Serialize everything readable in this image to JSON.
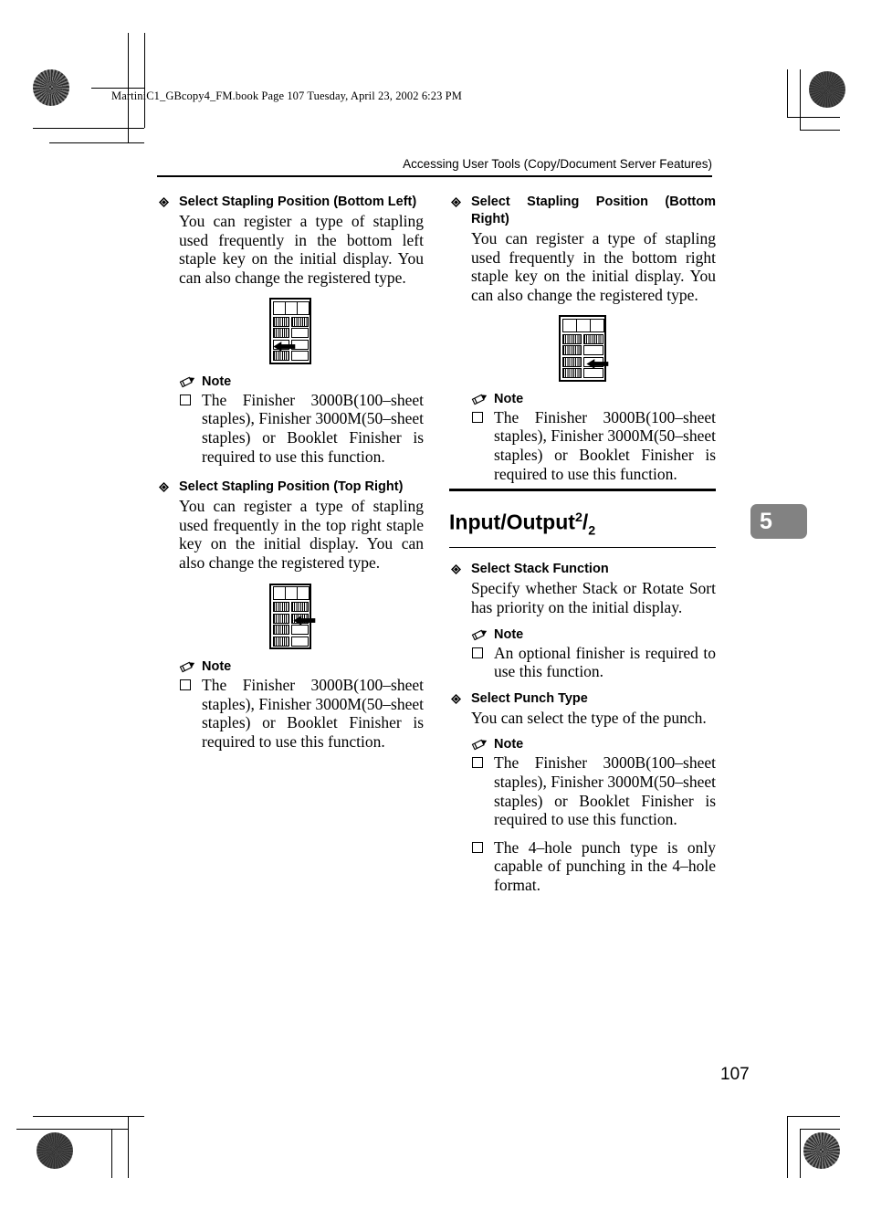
{
  "document": {
    "file_header": "MartiniC1_GBcopy4_FM.book  Page 107  Tuesday, April 23, 2002  6:23 PM",
    "running_head": "Accessing User Tools (Copy/Document Server Features)",
    "chapter_tab": "5",
    "page_number": "107",
    "tab_color": "#828282"
  },
  "left_column": {
    "block1": {
      "heading": "Select Stapling Position (Bottom Left)",
      "body": "You can register a type of stapling used frequently in the bottom left staple key on the initial display. You can also change the registered type.",
      "figure_name": "staple-position-bottom-left-panel",
      "note_label": "Note",
      "note_items": [
        "The Finisher 3000B(100–sheet staples), Finisher 3000M(50–sheet staples) or Booklet Finisher is required to use this function."
      ]
    },
    "block2": {
      "heading": "Select Stapling Position (Top Right)",
      "body": "You can register a type of stapling used frequently in the top right staple key on the initial display. You can also change the registered type.",
      "figure_name": "staple-position-top-right-panel",
      "note_label": "Note",
      "note_items": [
        "The Finisher 3000B(100–sheet staples), Finisher 3000M(50–sheet staples) or Booklet Finisher is required to use this function."
      ]
    }
  },
  "right_column": {
    "block1": {
      "heading": "Select Stapling Position (Bottom Right)",
      "body": "You can register a type of stapling used frequently in the bottom right staple key on the initial display. You can also change the registered type.",
      "figure_name": "staple-position-bottom-right-panel",
      "note_label": "Note",
      "note_items": [
        "The Finisher 3000B(100–sheet staples), Finisher 3000M(50–sheet staples) or Booklet Finisher is required to use this function."
      ]
    },
    "section": {
      "title_main": "Input/Output",
      "title_sup": "2",
      "title_slash": "/",
      "title_sub": "2"
    },
    "block2": {
      "heading": "Select Stack Function",
      "body": "Specify whether Stack or Rotate Sort has priority on the initial display.",
      "note_label": "Note",
      "note_items": [
        "An optional finisher is required to use this function."
      ]
    },
    "block3": {
      "heading": "Select Punch Type",
      "body": "You can select the type of the punch.",
      "note_label": "Note",
      "note_items": [
        "The Finisher 3000B(100–sheet staples), Finisher 3000M(50–sheet staples) or Booklet Finisher is required to use this function.",
        "The 4–hole punch type is only capable of punching in the 4–hole format."
      ]
    }
  }
}
